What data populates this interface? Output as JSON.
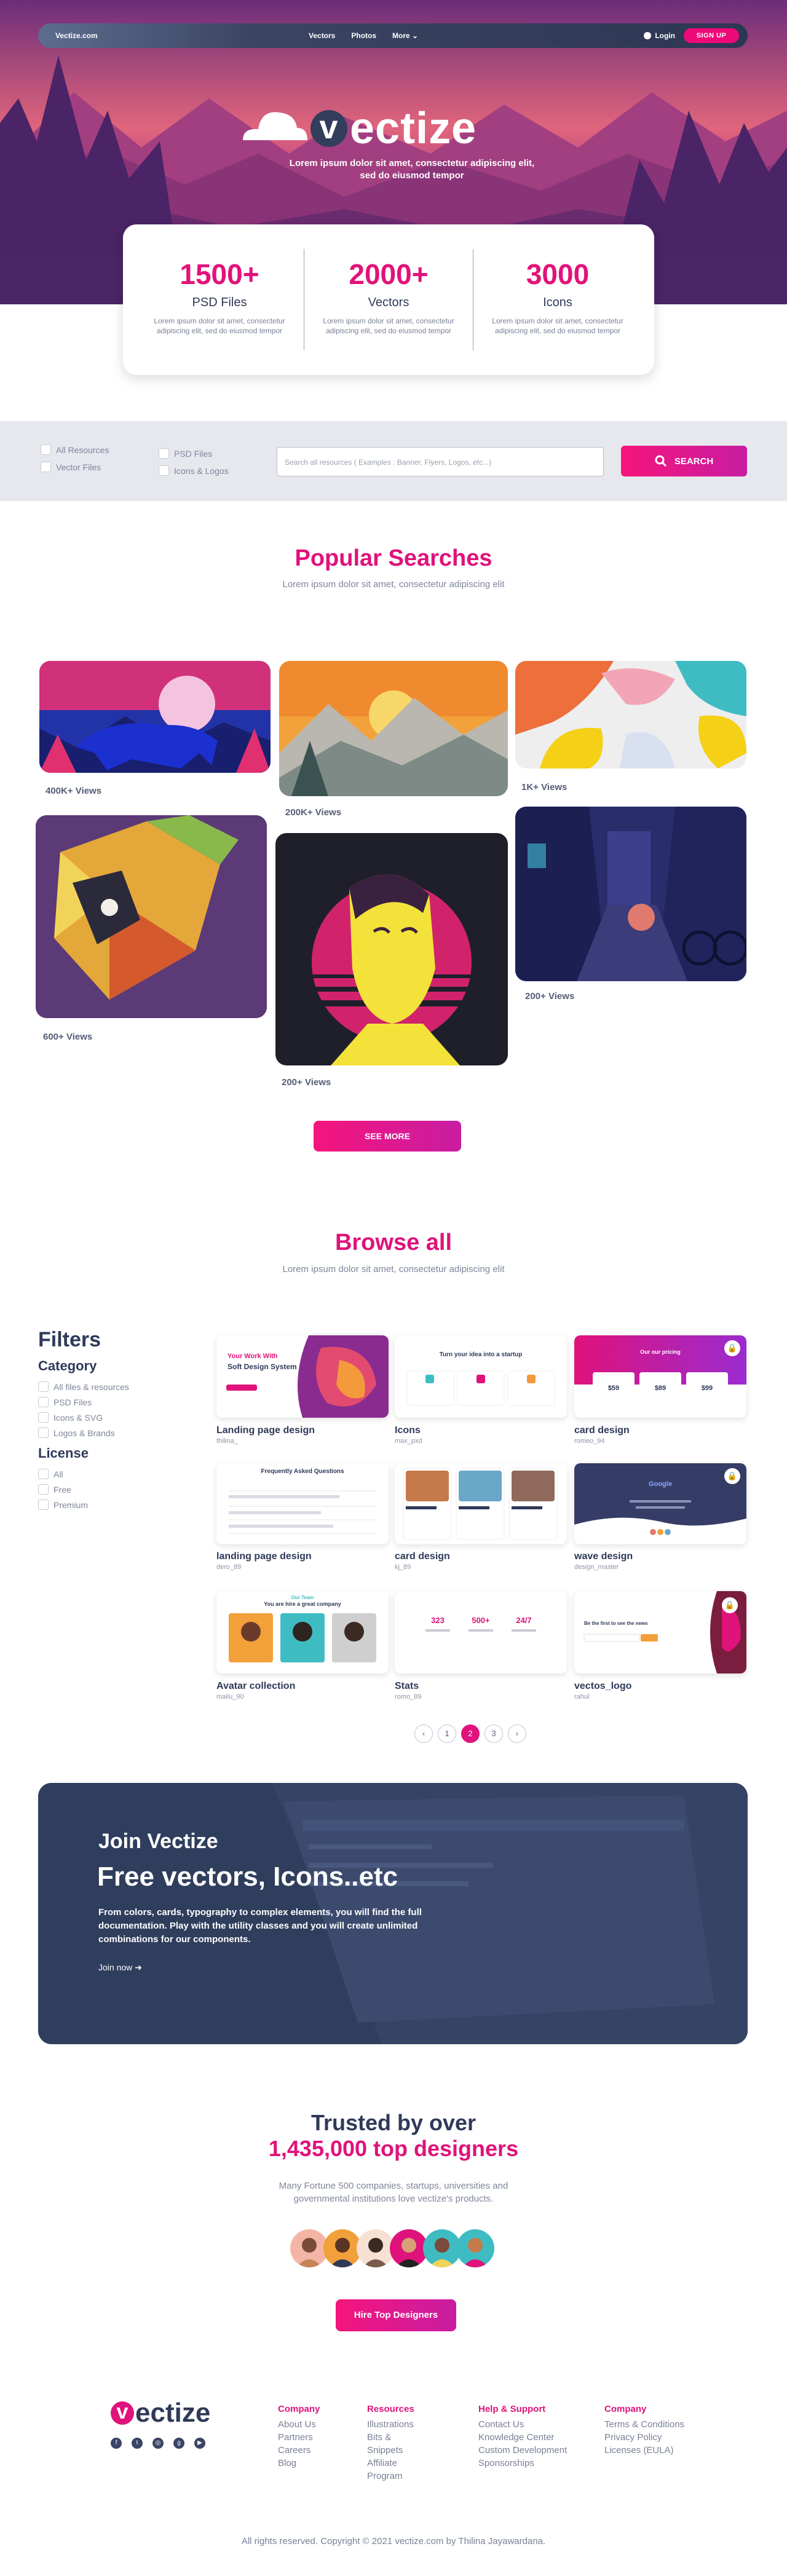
{
  "nav": {
    "brand": "Vectize.com",
    "links": [
      "Vectors",
      "Photos",
      "More ⌄"
    ],
    "login": "Login",
    "signup": "SIGN UP"
  },
  "hero": {
    "logo_v": "v",
    "logo_rest": "ectize",
    "tagline": "Lorem ipsum dolor sit amet, consectetur adipiscing elit, sed do eiusmod tempor"
  },
  "stats": [
    {
      "num": "1500+",
      "label": "PSD Files",
      "desc": "Lorem ipsum dolor sit amet, consectetur adipiscing elit, sed do eiusmod tempor"
    },
    {
      "num": "2000+",
      "label": "Vectors",
      "desc": "Lorem ipsum dolor sit amet, consectetur adipiscing elit, sed do eiusmod tempor"
    },
    {
      "num": "3000",
      "label": "Icons",
      "desc": "Lorem ipsum dolor sit amet, consectetur adipiscing elit, sed do eiusmod tempor"
    }
  ],
  "search": {
    "checkboxes": [
      "All Resources",
      "Vector Files",
      "PSD Files",
      "Icons & Logos"
    ],
    "placeholder": "Search all resources ( Examples : Banner, Flyers, Logos, etc...)",
    "button": "SEARCH"
  },
  "popular": {
    "title": "Popular Searches",
    "subtitle": "Lorem ipsum dolor sit amet, consectetur adipiscing elit",
    "views": [
      "400K+ Views",
      "200K+ Views",
      "1K+ Views",
      "600+ Views",
      "200+ Views",
      "200+ Views"
    ],
    "see_more": "SEE MORE"
  },
  "browse": {
    "title": "Browse all",
    "subtitle": "Lorem ipsum dolor sit amet, consectetur adipiscing elit"
  },
  "filters": {
    "title": "Filters",
    "category_title": "Category",
    "categories": [
      "All files & resources",
      "PSD Files",
      "Icons & SVG",
      "Logos & Brands"
    ],
    "license_title": "License",
    "licenses": [
      "All",
      "Free",
      "Premium"
    ]
  },
  "cards": [
    {
      "title": "Landing page design",
      "author": "thilina_",
      "text1": "Your Work With",
      "text2": "Soft Design System"
    },
    {
      "title": "Icons",
      "author": "max_pxd",
      "text1": "Turn your idea into a startup"
    },
    {
      "title": "card design",
      "author": "romeo_94",
      "text1": "Our our pricing",
      "prices": [
        "$59",
        "$89",
        "$99"
      ]
    },
    {
      "title": "landing page design",
      "author": "dero_89",
      "text1": "Frequently Asked Questions"
    },
    {
      "title": "card design",
      "author": "kj_89",
      "text1": ""
    },
    {
      "title": "wave design",
      "author": "design_master",
      "text1": "Google"
    },
    {
      "title": "Avatar collection",
      "author": "mailu_90",
      "text1": "Our Team",
      "text2": "You are hire a great company"
    },
    {
      "title": "Stats",
      "author": "romo_89",
      "nums": [
        "323",
        "500+",
        "24/7"
      ]
    },
    {
      "title": "vectos_logo",
      "author": "rahul",
      "text1": "Be the first to see the news"
    }
  ],
  "pagination": [
    "‹",
    "1",
    "2",
    "3",
    "›"
  ],
  "join": {
    "eyebrow": "Join Vectize",
    "headline": "Free vectors, Icons..etc",
    "body": "From colors, cards, typography to complex elements, you will find the full documentation. Play with the utility classes and you will create unlimited combinations for our components.",
    "link": "Join now ➔"
  },
  "trusted": {
    "line1": "Trusted by over",
    "line2": "1,435,000 top designers",
    "desc": "Many Fortune 500 companies, startups, universities and governmental institutions love vectize's products.",
    "button": "Hire Top Designers"
  },
  "footer": {
    "columns": [
      {
        "title": "Company",
        "links": [
          "About Us",
          "Partners",
          "Careers",
          "Blog"
        ]
      },
      {
        "title": "Resources",
        "links": [
          "Illustrations",
          "Bits &",
          "Snippets",
          "Affiliate",
          "Program"
        ]
      },
      {
        "title": "Help & Support",
        "links": [
          "Contact Us",
          "Knowledge Center",
          "Custom Development",
          "Sponsorships"
        ]
      },
      {
        "title": "Company",
        "links": [
          "Terms & Conditions",
          "Privacy Policy",
          "Licenses (EULA)"
        ]
      }
    ],
    "copyright": "All rights reserved. Copyright © 2021 vectize.com by Thilina Jayawardana."
  },
  "colors": {
    "accent": "#e0127b",
    "navy": "#2f3a59",
    "gradient_end": "#c81ca2"
  }
}
